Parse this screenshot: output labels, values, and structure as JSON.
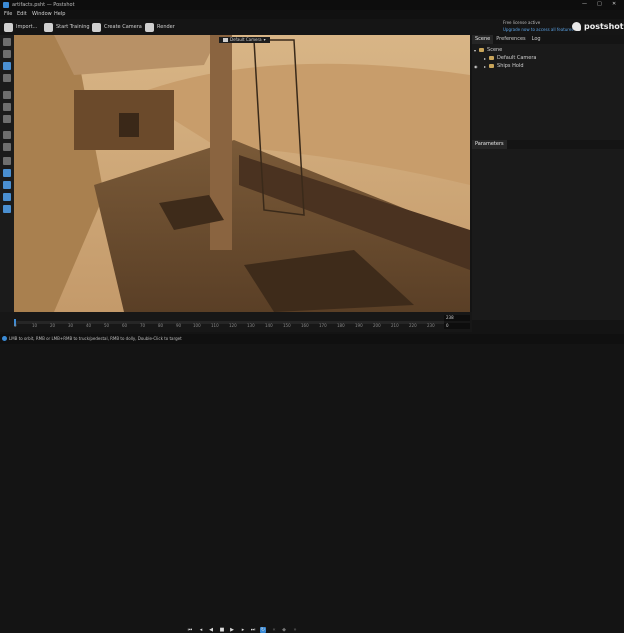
{
  "window": {
    "title": "artifacts.psht — Postshot",
    "controls": {
      "minimize": "—",
      "maximize": "□",
      "close": "✕"
    }
  },
  "menu": [
    "File",
    "Edit",
    "Window",
    "Help"
  ],
  "toolbar": {
    "import": "Import...",
    "start_training": "Start Training",
    "create_camera": "Create Camera",
    "render": "Render"
  },
  "license": {
    "line1": "Free license active",
    "line2": "Upgrade now to access all features"
  },
  "brand": "postshot",
  "viewport": {
    "camera_label": "Default Camera",
    "camera_dropdown": "▾"
  },
  "right_tabs": [
    "Scene",
    "Preferences",
    "Log"
  ],
  "scene_tree": {
    "root": "Scene",
    "items": [
      "Default Camera",
      "Ships Hold"
    ]
  },
  "parameters_label": "Parameters",
  "timeline": {
    "frame_value": "238",
    "end_value": "0",
    "ticks": [
      "0",
      "10",
      "20",
      "30",
      "40",
      "50",
      "60",
      "70",
      "80",
      "90",
      "100",
      "110",
      "120",
      "130",
      "140",
      "150",
      "160",
      "170",
      "180",
      "190",
      "200",
      "210",
      "220",
      "230"
    ]
  },
  "status": "LMB to orbit, RMB or LMB+RMB to truck/pedestal, RMB to dolly, Double-Click to target",
  "colors": {
    "accent": "#3b8bd6",
    "folder": "#c9a55a"
  }
}
